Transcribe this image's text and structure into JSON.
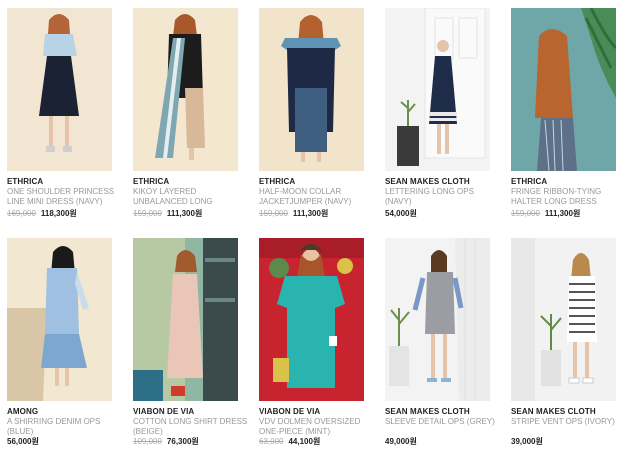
{
  "products": [
    {
      "brand": "ETHRICA",
      "name": "ONE SHOULDER PRINCESS LINE MINI DRESS (NAVY)",
      "original_price": "169,000",
      "price": "118,300원"
    },
    {
      "brand": "ETHRICA",
      "name": "KIKOY LAYERED UNBALANCED LONG",
      "original_price": "159,000",
      "price": "111,300원"
    },
    {
      "brand": "ETHRICA",
      "name": "HALF-MOON COLLAR JACKETJUMPER (NAVY)",
      "original_price": "159,000",
      "price": "111,300원"
    },
    {
      "brand": "SEAN MAKES CLOTH",
      "name": "LETTERING LONG OPS (NAVY)",
      "original_price": "",
      "price": "54,000원"
    },
    {
      "brand": "ETHRICA",
      "name": "FRINGE RIBBON-TYING HALTER LONG DRESS",
      "original_price": "159,000",
      "price": "111,300원"
    },
    {
      "brand": "AMONG",
      "name": "A SHIRRING DENIM OPS (BLUE)",
      "original_price": "",
      "price": "56,000원"
    },
    {
      "brand": "VIABON DE VIA",
      "name": "COTTON LONG SHIRT DRESS (BEIGE)",
      "original_price": "109,000",
      "price": "76,300원"
    },
    {
      "brand": "VIABON DE VIA",
      "name": "VDV DOLMEN OVERSIZED ONE-PIECE (MINT)",
      "original_price": "63,000",
      "price": "44,100원"
    },
    {
      "brand": "SEAN MAKES CLOTH",
      "name": "SLEEVE DETAIL OPS (GREY)",
      "original_price": "",
      "price": "49,000원"
    },
    {
      "brand": "SEAN MAKES CLOTH",
      "name": "STRIPE VENT OPS (IVORY)",
      "original_price": "",
      "price": "39,000원"
    }
  ]
}
